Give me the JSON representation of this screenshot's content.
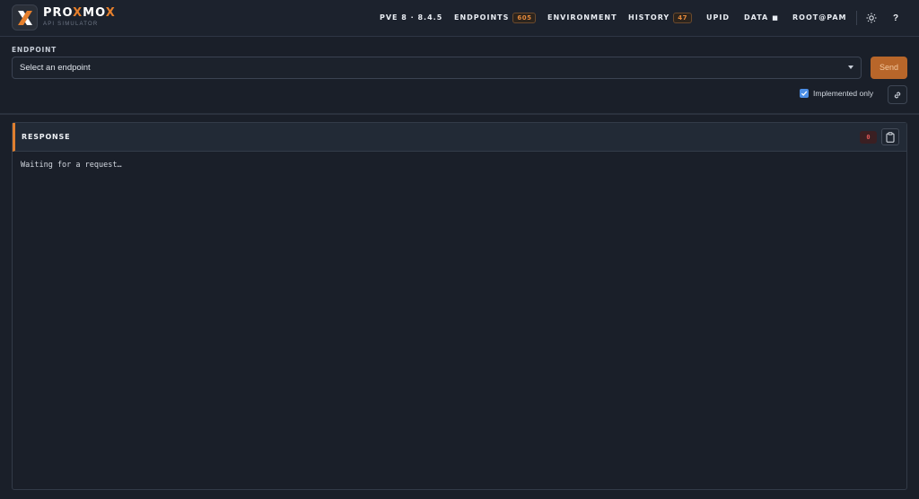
{
  "header": {
    "brand_prefix": "PRO",
    "brand_x": "X",
    "brand_mid": "MO",
    "brand_x2": "X",
    "brand_sub": "API SIMULATOR",
    "logo_icon": "proxmox-x-icon",
    "nav": {
      "version": "PVE 8 · 8.4.5",
      "endpoints": "ENDPOINTS",
      "endpoints_count": "605",
      "environment": "ENVIRONMENT",
      "history": "HISTORY",
      "history_count": "47",
      "upid": "UPID",
      "data": "DATA",
      "data_glyph": "■",
      "user": "ROOT@PAM"
    },
    "theme_icon": "sun-icon",
    "help_label": "?"
  },
  "endpoint": {
    "label": "ENDPOINT",
    "select_value": "Select an endpoint",
    "send_label": "Send",
    "implemented_only_label": "Implemented only",
    "implemented_only_checked": true,
    "link_icon": "link-icon"
  },
  "response": {
    "title": "RESPONSE",
    "status_code": "0",
    "body": "Waiting for a request…",
    "copy_icon": "clipboard-icon"
  },
  "colors": {
    "accent": "#e57f2c",
    "background": "#1a1f29",
    "send_button": "#b8662a",
    "error": "#e35858"
  }
}
